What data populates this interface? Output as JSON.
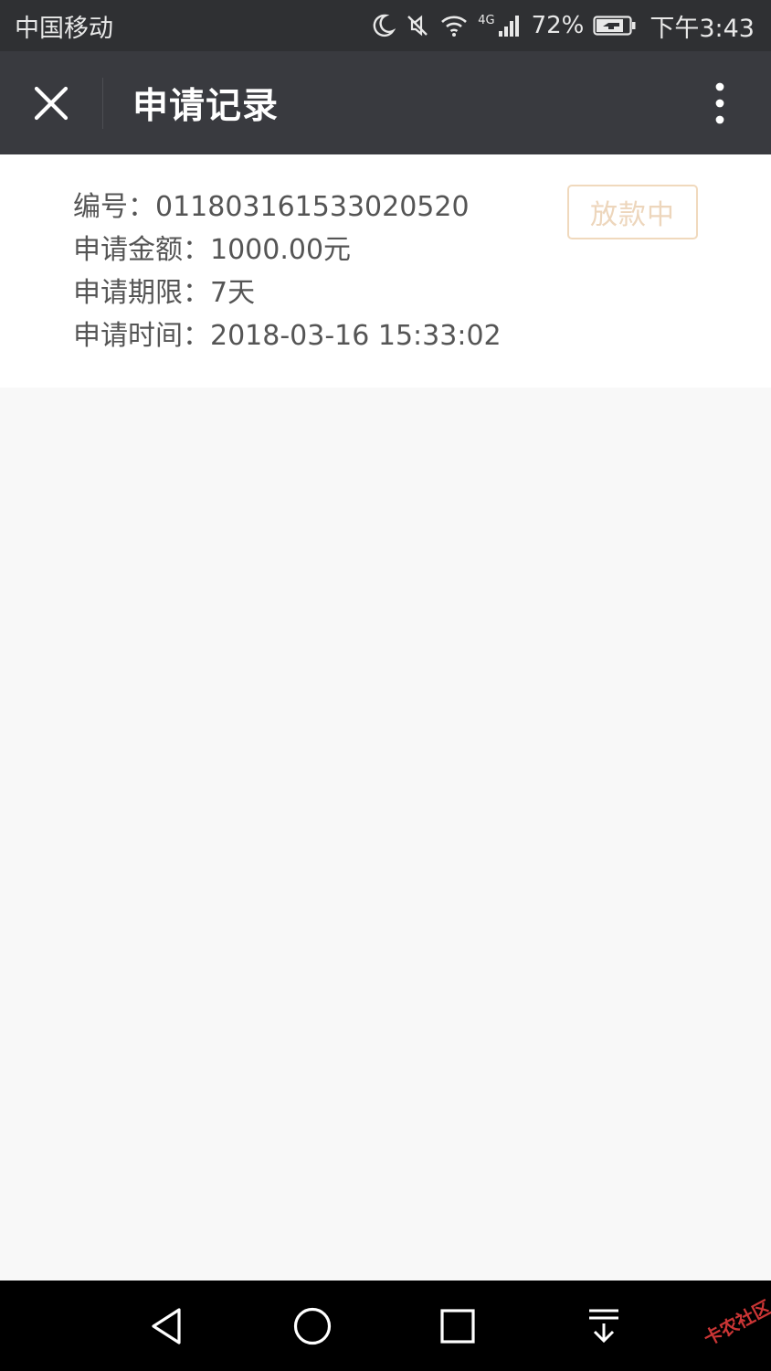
{
  "status_bar": {
    "carrier": "中国移动",
    "network": "4G",
    "battery_percent": "72%",
    "time": "下午3:43"
  },
  "title_bar": {
    "title": "申请记录",
    "close_icon": "close-icon",
    "more_icon": "more-vertical-icon"
  },
  "record": {
    "lines": [
      {
        "label": "编号：",
        "value": "011803161533020520"
      },
      {
        "label": "申请金额：",
        "value": "1000.00元"
      },
      {
        "label": "申请期限：",
        "value": "7天"
      },
      {
        "label": "申请时间：",
        "value": "2018-03-16 15:33:02"
      }
    ],
    "status": "放款中",
    "status_color": "#edd6bc"
  },
  "nav_bar": {
    "buttons": [
      "back-triangle-icon",
      "home-circle-icon",
      "recents-square-icon",
      "notification-pull-icon"
    ]
  },
  "watermark": "卡农社区"
}
